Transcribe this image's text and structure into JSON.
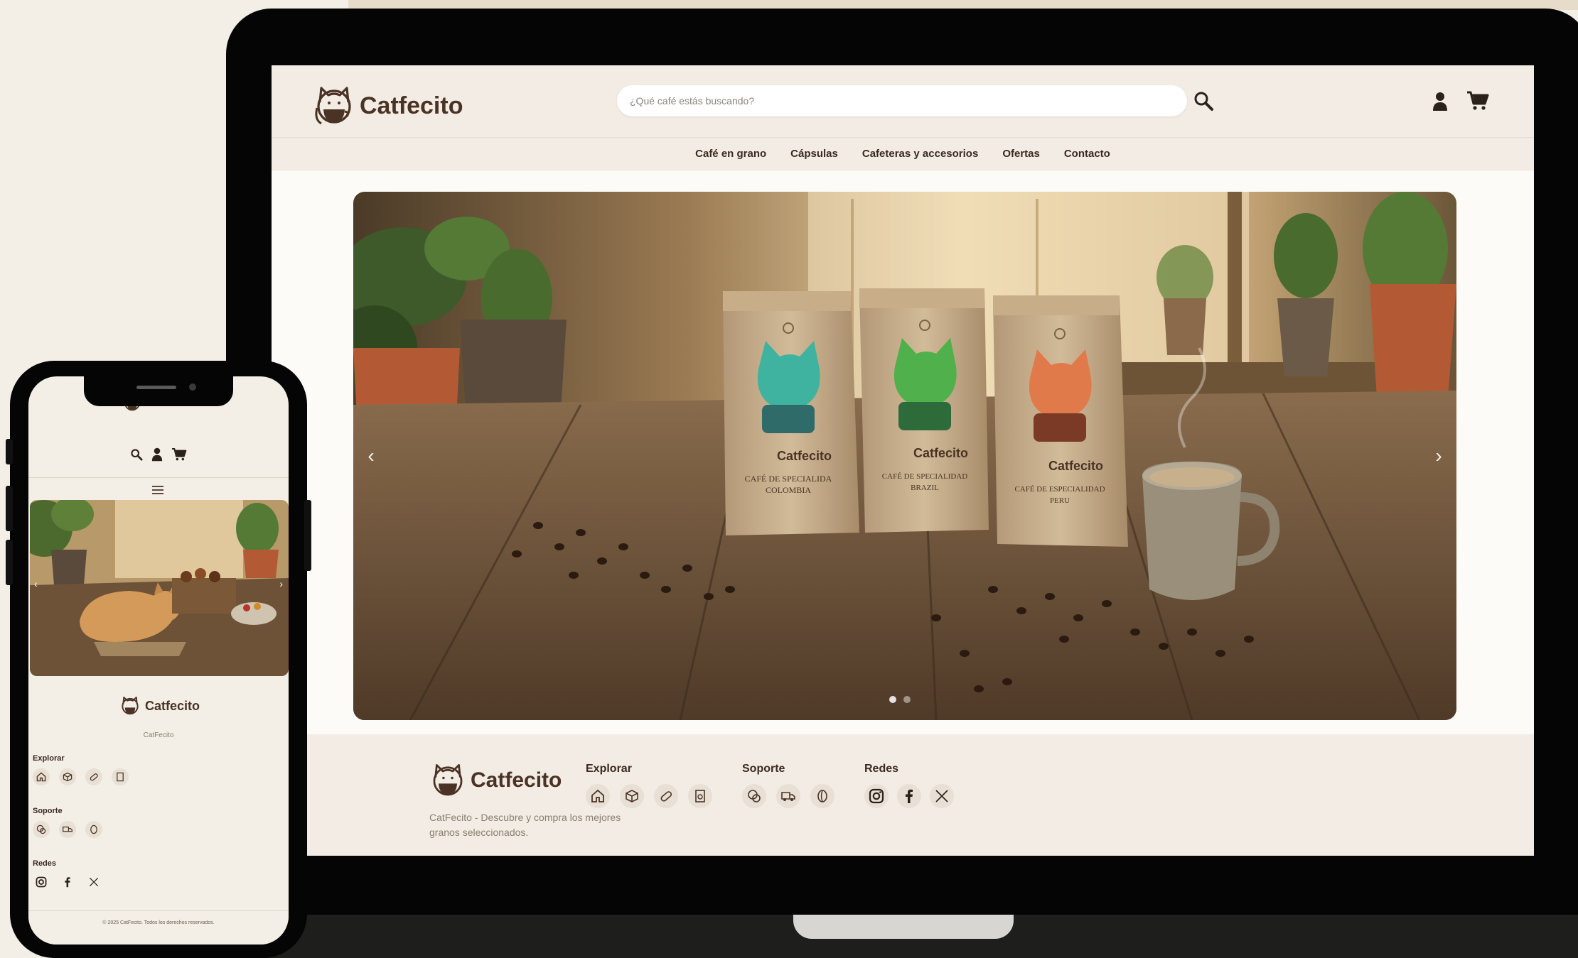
{
  "brand": {
    "name": "Catfecito"
  },
  "header": {
    "search_placeholder": "¿Qué café estás buscando?",
    "icons": [
      "search-icon",
      "user-icon",
      "cart-icon"
    ]
  },
  "nav": [
    {
      "label": "Café en grano"
    },
    {
      "label": "Cápsulas"
    },
    {
      "label": "Cafeteras y accesorios"
    },
    {
      "label": "Ofertas"
    },
    {
      "label": "Contacto"
    }
  ],
  "hero": {
    "prev_glyph": "‹",
    "next_glyph": "›",
    "active_slide": 1,
    "slide_count": 2,
    "bags": [
      {
        "brand": "Catfecito",
        "title": "CAFÉ DE SPECIALIDA",
        "origin": "COLOMBIA",
        "cat_color": "#3fb3a0"
      },
      {
        "brand": "Catfecito",
        "title": "CAFÉ DE SPECIALIDAD",
        "origin": "BRAZIL",
        "cat_color": "#4fb04c"
      },
      {
        "brand": "Catfecito",
        "title": "CAFÉ DE ESPECIALIDAD",
        "origin": "PERU",
        "cat_color": "#e07a4a"
      }
    ]
  },
  "footer": {
    "description": "CatFecito - Descubre y compra los mejores granos seleccionados.",
    "columns": [
      {
        "title": "Explorar",
        "icons": [
          "home-icon",
          "box-icon",
          "capsule-icon",
          "coffee-bag-icon"
        ]
      },
      {
        "title": "Soporte",
        "icons": [
          "chat-icon",
          "delivery-truck-icon",
          "coffee-bean-icon"
        ]
      },
      {
        "title": "Redes",
        "icons": [
          "instagram-icon",
          "facebook-icon",
          "x-icon"
        ]
      }
    ]
  },
  "mobile": {
    "footer_brand_caption": "CatFecito",
    "copyright": "© 2025 CatFecito. Todos los derechos reservados."
  },
  "colors": {
    "brand_brown": "#4a3324",
    "cream": "#f2ece4",
    "icon_circle": "#e8e0d5"
  }
}
